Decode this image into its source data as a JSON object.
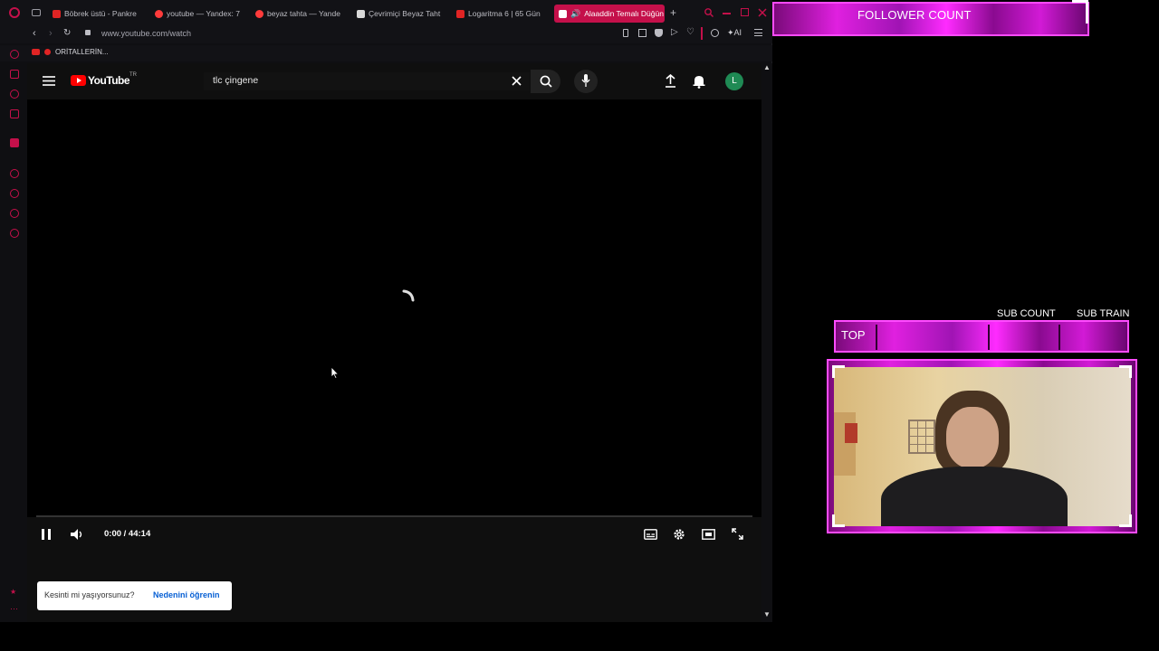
{
  "browser": {
    "tabs": [
      {
        "label": "Böbrek üstü - Pankre",
        "color": "#e02424"
      },
      {
        "label": "youtube — Yandex: 7",
        "color": "#ff3b3b"
      },
      {
        "label": "beyaz tahta — Yande",
        "color": "#ff3b3b"
      },
      {
        "label": "Çevrimiçi Beyaz Taht",
        "color": "#d8d8d8"
      },
      {
        "label": "Logaritma 6 | 65 Gün",
        "color": "#e02424"
      },
      {
        "label": "Alaaddin Temalı Düğün",
        "color": "#e02424"
      }
    ],
    "url": "www.youtube.com/watch",
    "ai_label": "AI",
    "bookmark": "ORİTALLERİN..."
  },
  "youtube": {
    "logo_text": "YouTube",
    "region": "TR",
    "search_value": "tlc çingene",
    "avatar_letter": "L",
    "time": "0:00 / 44:14",
    "progress": 0.0,
    "toast_text": "Kesinti mi yaşıyorsunuz?",
    "toast_link": "Nedenini öğrenin"
  },
  "overlay": {
    "follower_count": "FOLLOWER COUNT",
    "sub_count": "SUB COUNT",
    "sub_train": "SUB TRAIN",
    "top_label": "TOP"
  },
  "colors": {
    "opera_red": "#c4104a",
    "youtube_red": "#ff0000",
    "overlay_magenta": "#e020e0",
    "avatar_green": "#1f8a54"
  }
}
